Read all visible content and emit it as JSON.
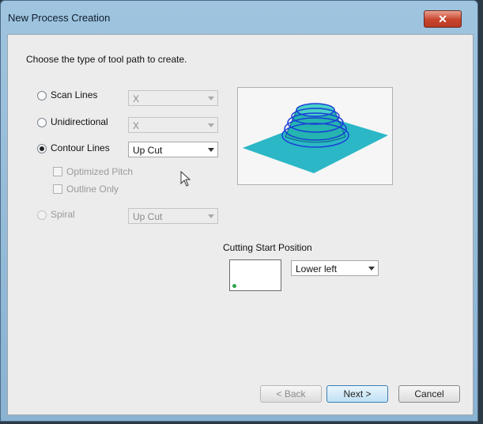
{
  "window": {
    "title": "New Process Creation",
    "close_symbol": "✕"
  },
  "instruction": "Choose the type of tool path to create.",
  "toolpath_options": {
    "scan_lines": {
      "label": "Scan Lines",
      "selected": false,
      "enabled": true,
      "direction_value": "X",
      "combo_enabled": false
    },
    "unidirectional": {
      "label": "Unidirectional",
      "selected": false,
      "enabled": true,
      "direction_value": "X",
      "combo_enabled": false
    },
    "contour_lines": {
      "label": "Contour Lines",
      "selected": true,
      "enabled": true,
      "cut_value": "Up Cut",
      "combo_enabled": true
    },
    "optimized_pitch": {
      "label": "Optimized Pitch",
      "checked": false,
      "enabled": false
    },
    "outline_only": {
      "label": "Outline Only",
      "checked": false,
      "enabled": false
    },
    "spiral": {
      "label": "Spiral",
      "selected": false,
      "enabled": false,
      "cut_value": "Up Cut",
      "combo_enabled": false
    }
  },
  "cutting_start": {
    "label": "Cutting Start Position",
    "value": "Lower left"
  },
  "buttons": {
    "back": "< Back",
    "next": "Next >",
    "cancel": "Cancel"
  },
  "colors": {
    "preview_plane": "#2bb7c6",
    "preview_rings": "#1a3fd6",
    "cone_fill": "#25b4b0",
    "start_dot": "#2ea34a"
  }
}
